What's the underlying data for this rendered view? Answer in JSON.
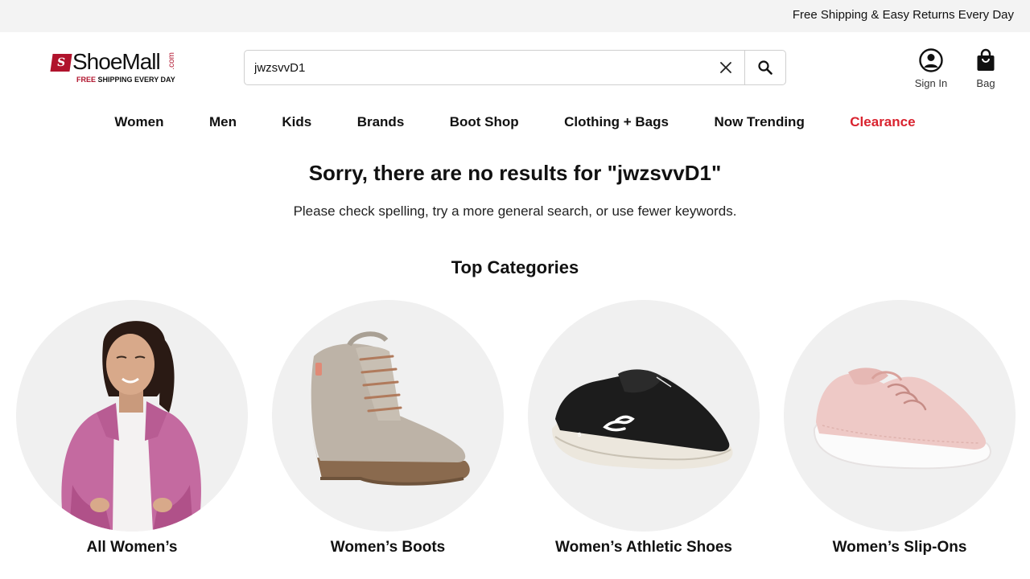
{
  "promo": {
    "text": "Free Shipping & Easy Returns Every Day"
  },
  "logo": {
    "mark": "S",
    "word": "ShoeMall",
    "com": ".com",
    "tagline_red": "FREE",
    "tagline_rest": " SHIPPING EVERY DAY"
  },
  "search": {
    "value": "jwzsvvD1",
    "clear_icon": "close-icon",
    "submit_icon": "search-icon"
  },
  "header": {
    "account_label": "Sign In",
    "account_icon": "user-circle-icon",
    "bag_label": "Bag",
    "bag_icon": "shopping-bag-icon"
  },
  "nav": {
    "items": [
      "Women",
      "Men",
      "Kids",
      "Brands",
      "Boot Shop",
      "Clothing + Bags",
      "Now Trending",
      "Clearance"
    ],
    "clearance_color": "#d9232f"
  },
  "results": {
    "prefix": "Sorry, there are no results for ",
    "query": "\"jwzsvvD1\"",
    "hint": "Please check spelling, try a more general search, or use fewer keywords."
  },
  "categories": {
    "heading": "Top Categories",
    "items": [
      {
        "label": "All Women’s",
        "image": "woman-in-pink-fleece-jacket"
      },
      {
        "label": "Women’s Boots",
        "image": "taupe-suede-lace-up-boot"
      },
      {
        "label": "Women’s Athletic Shoes",
        "image": "black-knit-athletic-sneaker"
      },
      {
        "label": "Women’s Slip-Ons",
        "image": "pink-canvas-slip-on-sneaker"
      }
    ]
  },
  "colors": {
    "brand_red": "#b0132c",
    "promo_bg": "#f3f3f3",
    "circle_bg": "#f0f0f0"
  }
}
